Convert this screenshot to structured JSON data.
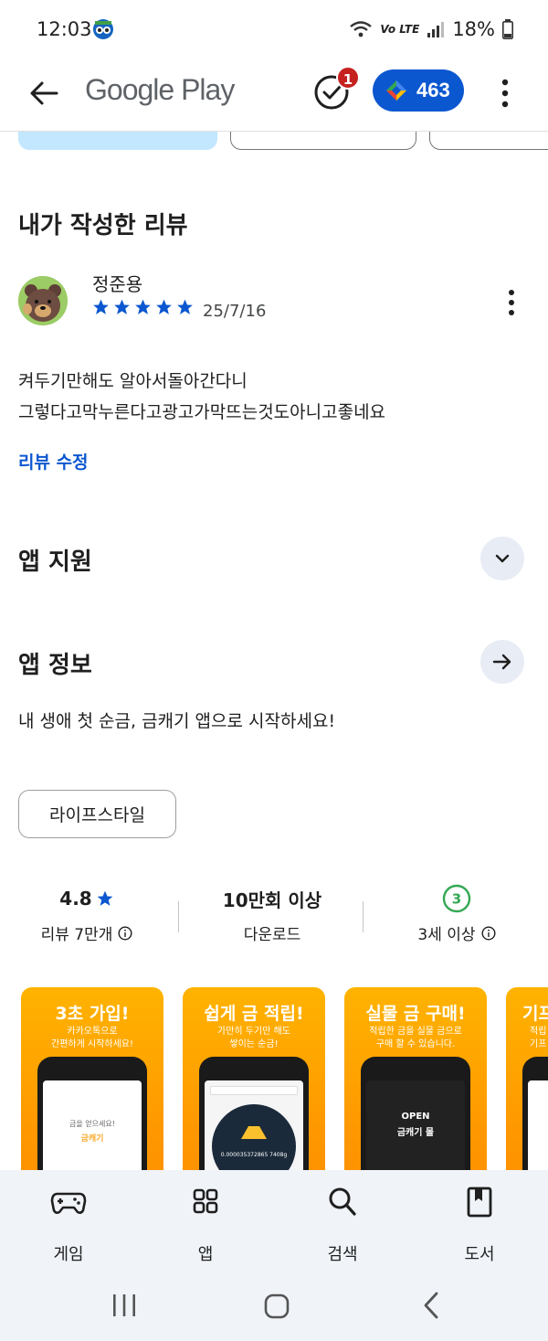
{
  "status_bar": {
    "time": "12:03",
    "network": "Vo LTE",
    "battery": "18%"
  },
  "app_bar": {
    "logo": "Google Play",
    "task_badge": "1",
    "points": "463"
  },
  "review_section": {
    "title": "내가 작성한 리뷰",
    "reviewer": "정준용",
    "rating": 5,
    "date": "25/7/16",
    "text_line1": "켜두기만해도 알아서돌아간다니",
    "text_line2": "그렇다고막누른다고광고가막뜨는것도아니고좋네요",
    "edit_label": "리뷰 수정"
  },
  "support": {
    "title": "앱 지원"
  },
  "about": {
    "title": "앱 정보",
    "description": "내 생애 첫 순금, 금캐기 앱으로 시작하세요!",
    "category": "라이프스타일"
  },
  "stats": {
    "rating": "4.8",
    "rating_label": "리뷰 7만개",
    "downloads": "10만회 이상",
    "downloads_label": "다운로드",
    "age_icon": "3",
    "age_label": "3세 이상"
  },
  "screenshots": [
    {
      "title": "3초 가입!",
      "sub1": "카카오톡으로",
      "sub2": "간편하게 시작하세요!"
    },
    {
      "title": "쉽게 금 적립!",
      "sub1": "가만히 두기만 해도",
      "sub2": "쌓이는 순금!"
    },
    {
      "title": "실물 금 구매!",
      "sub1": "적립한 금을 실물 금으로",
      "sub2": "구매 할 수 있습니다."
    },
    {
      "title": "기프",
      "sub1": "적립",
      "sub2": "기프"
    }
  ],
  "screenshot_inner": {
    "s1_line1": "금을 얻으세요!",
    "s1_line2": "금캐기",
    "s2_amount": "0.000035372865 7408g",
    "s3_open": "OPEN",
    "s3_store": "금캐기 몰"
  },
  "bottom_nav": {
    "games": "게임",
    "apps": "앱",
    "search": "검색",
    "books": "도서"
  },
  "colors": {
    "accent": "#0b57d0",
    "badge": "#c5221f",
    "star": "#0b57d0",
    "age_green": "#34a853"
  }
}
